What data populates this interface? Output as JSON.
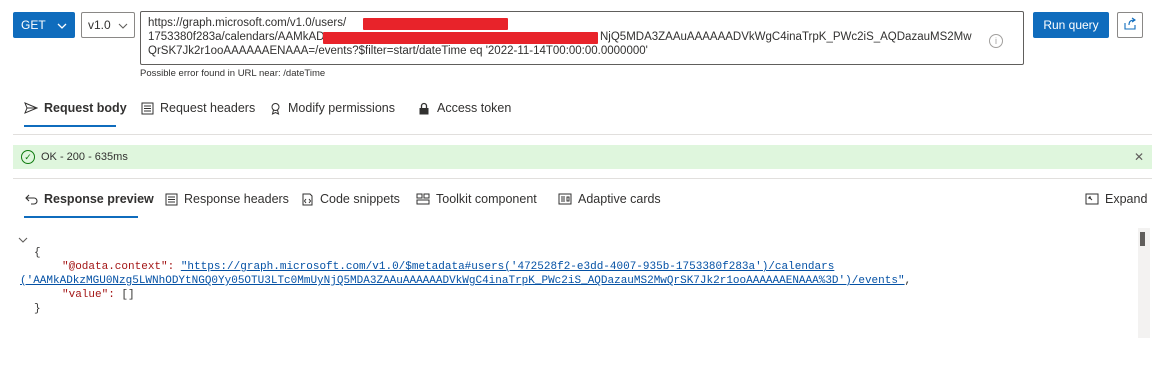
{
  "toolbar": {
    "method": "GET",
    "version": "v1.0",
    "url_lines": [
      "https://graph.microsoft.com/v1.0/users/",
      "1753380f283a/calendars/AAMkAD",
      "NjQ5MDA3ZAAuAAAAAADVkWgC4inaTrpK_PWc2iS_AQDazauMS2Mw",
      "QrSK7Jk2r1ooAAAAAAENAAA=/events?$filter=start/dateTime eq '2022-11-14T00:00:00.0000000'"
    ],
    "url_error": "Possible error found in URL near: /dateTime",
    "run_label": "Run query"
  },
  "request_tabs": [
    {
      "label": "Request body",
      "icon": "send-icon"
    },
    {
      "label": "Request headers",
      "icon": "headers-icon"
    },
    {
      "label": "Modify permissions",
      "icon": "permissions-icon"
    },
    {
      "label": "Access token",
      "icon": "lock-icon"
    }
  ],
  "status": {
    "text": "OK - 200 - 635ms",
    "color": "#dff6dd"
  },
  "response_tabs": [
    {
      "label": "Response preview",
      "icon": "undo-arrow-icon"
    },
    {
      "label": "Response headers",
      "icon": "headers-icon"
    },
    {
      "label": "Code snippets",
      "icon": "code-icon"
    },
    {
      "label": "Toolkit component",
      "icon": "toolkit-icon"
    },
    {
      "label": "Adaptive cards",
      "icon": "card-icon"
    }
  ],
  "expand_label": "Expand",
  "response": {
    "open_brace": "{",
    "context_key": "\"@odata.context\": ",
    "context_value_1": "\"https://graph.microsoft.com/v1.0/$metadata#users('472528f2-e3dd-4007-935b-1753380f283a')/calendars",
    "context_value_2": "('AAMkADkzMGU0Nzg5LWNhODYtNGQ0Yy05OTU3LTc0MmUyNjQ5MDA3ZAAuAAAAAADVkWgC4inaTrpK_PWc2iS_AQDazauMS2MwQrSK7Jk2r1ooAAAAAAENAAA%3D')/events\"",
    "context_tail": ",",
    "value_key": "\"value\": ",
    "value_val": "[]",
    "close_brace": "}"
  },
  "colors": {
    "accent": "#0f6cbd",
    "success_bg": "#dff6dd",
    "redaction": "#e8232a"
  }
}
